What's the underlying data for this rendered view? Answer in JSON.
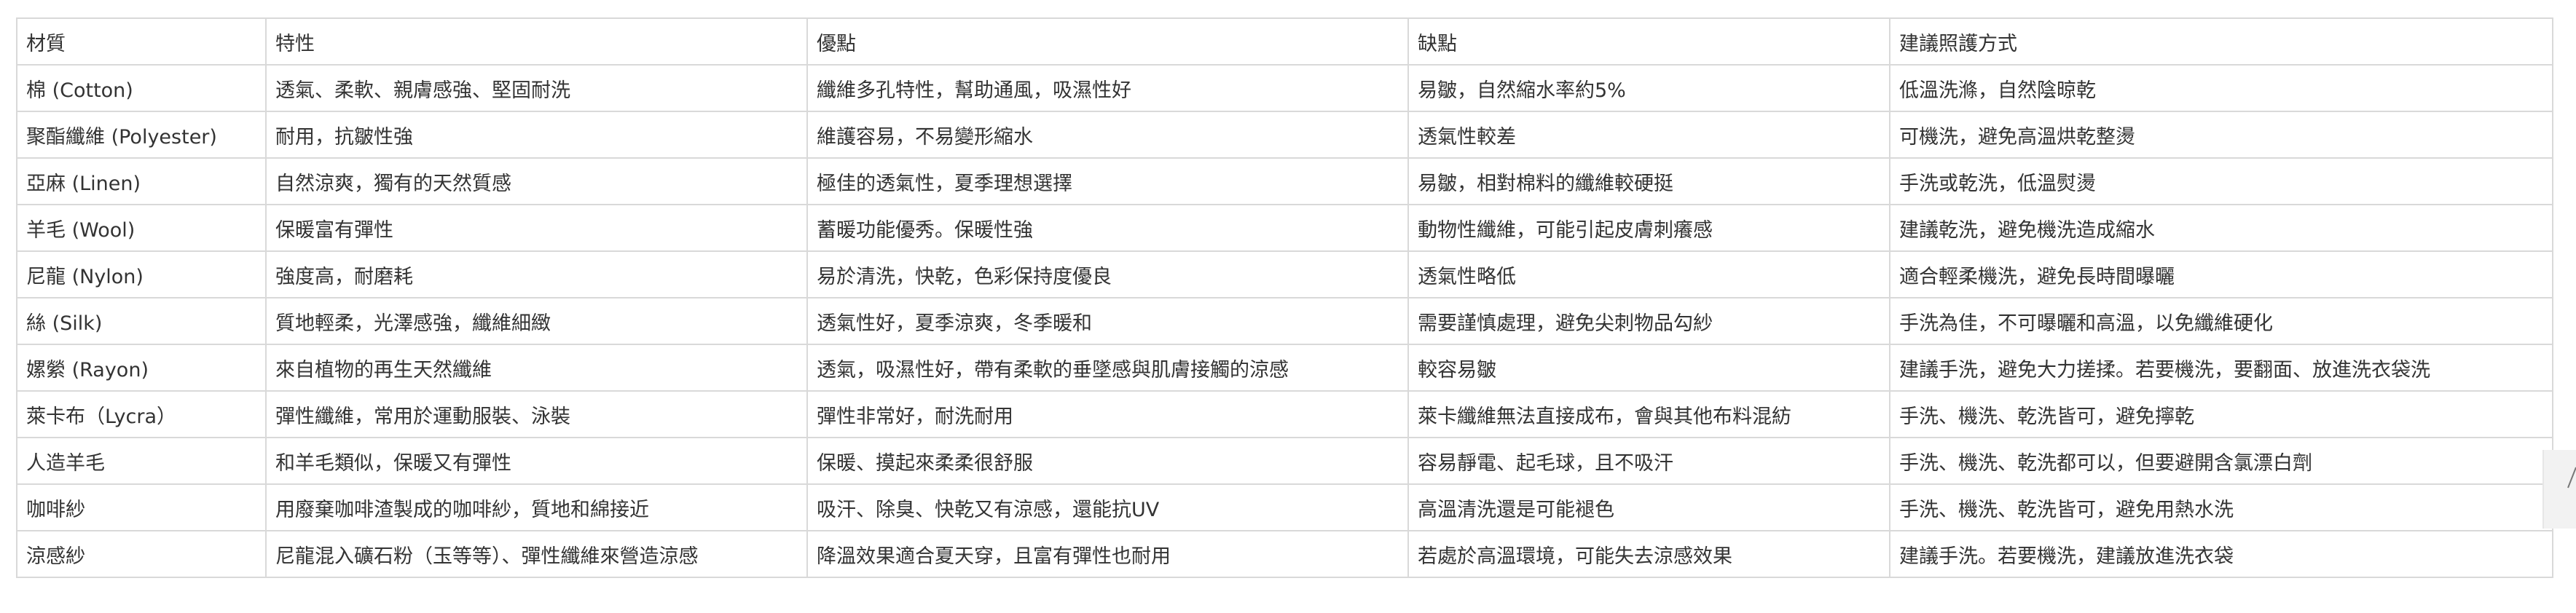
{
  "table": {
    "headers": [
      "材質",
      "特性",
      "優點",
      "缺點",
      "建議照護方式"
    ],
    "rows": [
      [
        "棉 (Cotton)",
        "透氣、柔軟、親膚感強、堅固耐洗",
        "纖維多孔特性，幫助通風，吸濕性好",
        "易皺，自然縮水率約5%",
        "低溫洗滌，自然陰晾乾"
      ],
      [
        "聚酯纖維 (Polyester)",
        "耐用，抗皺性強",
        "維護容易，不易變形縮水",
        "透氣性較差",
        "可機洗，避免高溫烘乾整燙"
      ],
      [
        "亞麻 (Linen)",
        "自然涼爽，獨有的天然質感",
        "極佳的透氣性，夏季理想選擇",
        "易皺，相對棉料的纖維較硬挺",
        "手洗或乾洗，低溫熨燙"
      ],
      [
        "羊毛 (Wool)",
        "保暖富有彈性",
        "蓄暖功能優秀。保暖性強",
        "動物性纖維，可能引起皮膚刺癢感",
        "建議乾洗，避免機洗造成縮水"
      ],
      [
        "尼龍 (Nylon)",
        "強度高，耐磨耗",
        "易於清洗，快乾，色彩保持度優良",
        "透氣性略低",
        "適合輕柔機洗，避免長時間曝曬"
      ],
      [
        "絲 (Silk)",
        "質地輕柔，光澤感強，纖維細緻",
        "透氣性好，夏季涼爽，冬季暖和",
        "需要謹慎處理，避免尖刺物品勾紗",
        "手洗為佳，不可曝曬和高溫，以免纖維硬化"
      ],
      [
        "嫘縈 (Rayon)",
        "來自植物的再生天然纖維",
        "透氣，吸濕性好，帶有柔軟的垂墜感與肌膚接觸的涼感",
        "較容易皺",
        "建議手洗，避免大力搓揉。若要機洗，要翻面、放進洗衣袋洗"
      ],
      [
        "萊卡布（Lycra）",
        "彈性纖維，常用於運動服裝、泳裝",
        "彈性非常好，耐洗耐用",
        "萊卡纖維無法直接成布，會與其他布料混紡",
        "手洗、機洗、乾洗皆可，避免擰乾"
      ],
      [
        "人造羊毛",
        "和羊毛類似，保暖又有彈性",
        "保暖、摸起來柔柔很舒服",
        "容易靜電、起毛球，且不吸汗",
        "手洗、機洗、乾洗都可以，但要避開含氯漂白劑"
      ],
      [
        "咖啡紗",
        "用廢棄咖啡渣製成的咖啡紗，質地和綿接近",
        "吸汗、除臭、快乾又有涼感，還能抗UV",
        "高溫清洗還是可能褪色",
        "手洗、機洗、乾洗皆可，避免用熱水洗"
      ],
      [
        "涼感紗",
        "尼龍混入礦石粉（玉等等）、彈性纖維來營造涼感",
        "降溫效果適合夏天穿，且富有彈性也耐用",
        "若處於高溫環境，可能失去涼感效果",
        "建議手洗。若要機洗，建議放進洗衣袋"
      ]
    ]
  }
}
